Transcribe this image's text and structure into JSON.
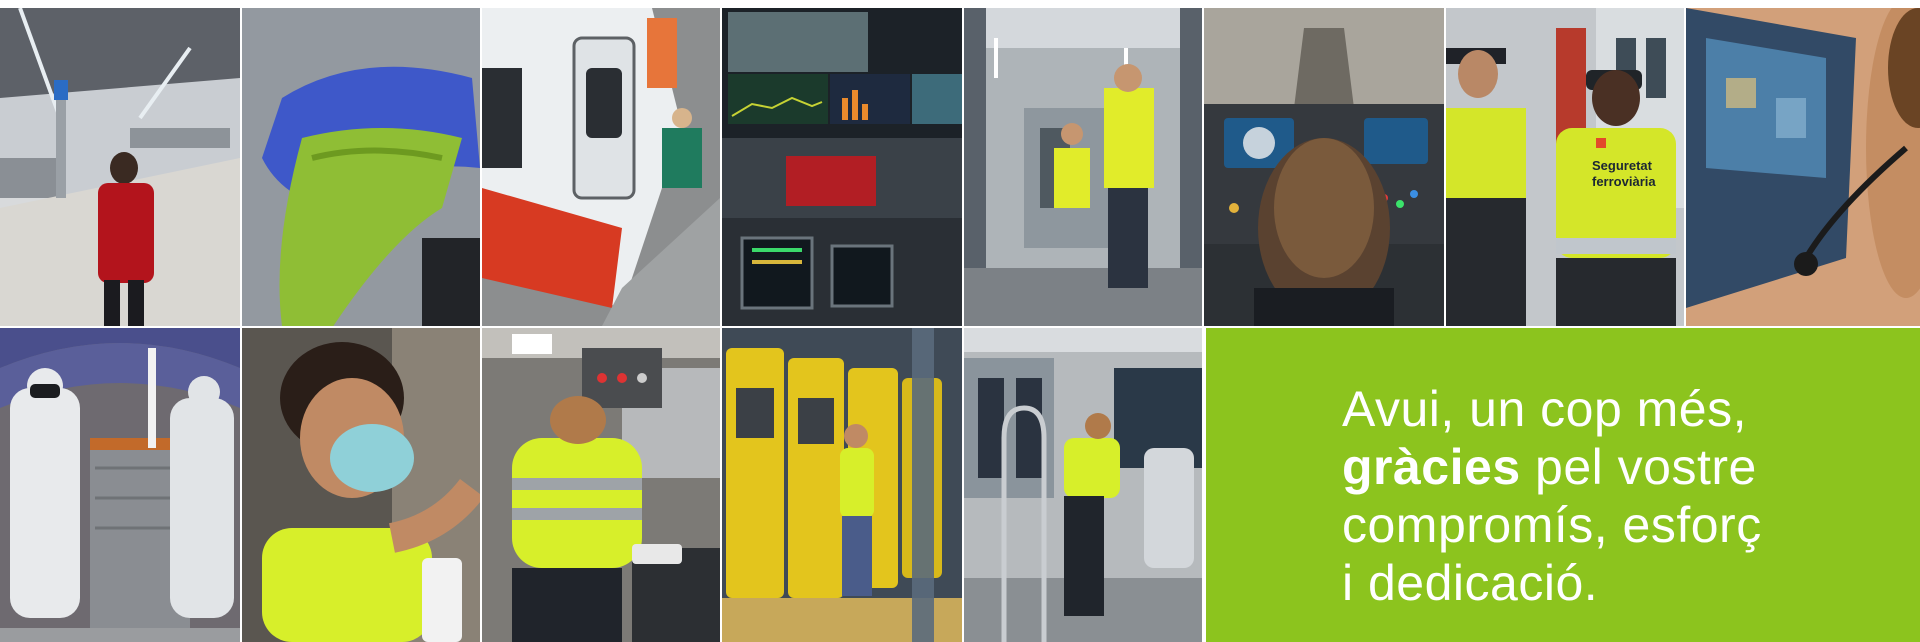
{
  "photos": [
    {
      "icon": "station-platform-photo"
    },
    {
      "icon": "cleaning-glove-photo"
    },
    {
      "icon": "train-exterior-photo"
    },
    {
      "icon": "control-room-photo"
    },
    {
      "icon": "train-interior-worker-photo"
    },
    {
      "icon": "train-cab-driver-photo"
    },
    {
      "icon": "security-staff-photo"
    },
    {
      "icon": "headset-operator-photo"
    },
    {
      "icon": "disinfection-crew-photo"
    },
    {
      "icon": "masked-cleaner-photo"
    },
    {
      "icon": "cab-cleaning-photo"
    },
    {
      "icon": "ticket-machine-cleaning-photo"
    },
    {
      "icon": "carriage-cleaning-photo"
    }
  ],
  "vest_label": {
    "line1": "Seguretat",
    "line2": "ferroviària"
  },
  "message": {
    "line1": "Avui, un cop més,",
    "line2_bold": "gràcies",
    "line2_rest": " pel vostre",
    "line3": "compromís, esforç",
    "line4": "i dedicació."
  },
  "colors": {
    "accent_green": "#8cc41e",
    "hi_vis_yellow": "#d7ef2a",
    "text": "#ffffff"
  }
}
